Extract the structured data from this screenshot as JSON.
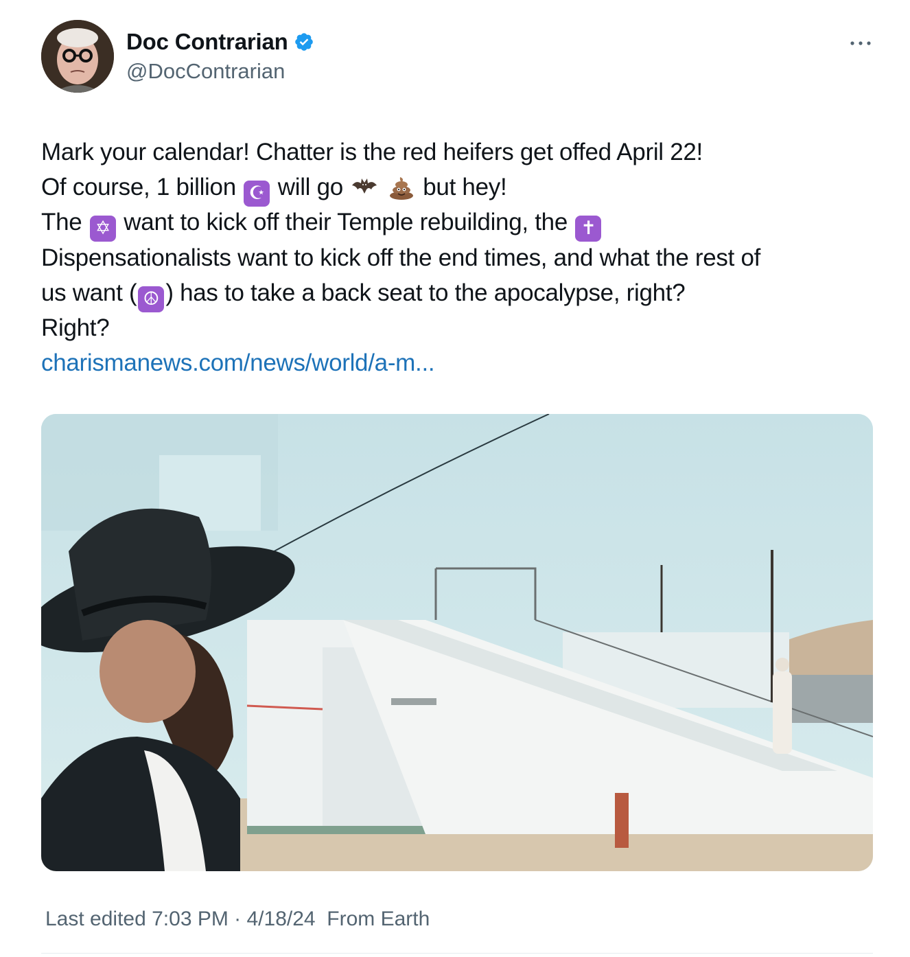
{
  "author": {
    "display_name": "Doc Contrarian",
    "handle": "@DocContrarian",
    "verified": true
  },
  "tweet": {
    "line1": "Mark your calendar! Chatter is the red heifers get offed April 22!",
    "line2_a": "Of course, 1 billion",
    "line2_b": "will go",
    "line2_c": "but hey!",
    "line3_a": "The",
    "line3_b": "want to kick off their Temple rebuilding, the",
    "line4": "Dispensationalists want to kick off the end times, and what the rest of",
    "line5_a": "us want (",
    "line5_b": ") has to take a back seat to the apocalypse, right?",
    "line6": "Right?",
    "link_text": "charismanews.com/news/world/a-m..."
  },
  "emojis": {
    "star_and_crescent": "☪",
    "bat": "bat-emoji",
    "poop": "pile-of-poo-emoji",
    "star_of_david": "✡",
    "cross": "✝",
    "peace": "☮"
  },
  "meta": {
    "edited_label": "Last edited 7:03 PM · 4/18/24",
    "location": "From Earth"
  },
  "colors": {
    "verified_blue": "#1d9bf0",
    "link_blue": "#1d72b8",
    "emoji_purple": "#9b59d0",
    "secondary_text": "#536471"
  }
}
